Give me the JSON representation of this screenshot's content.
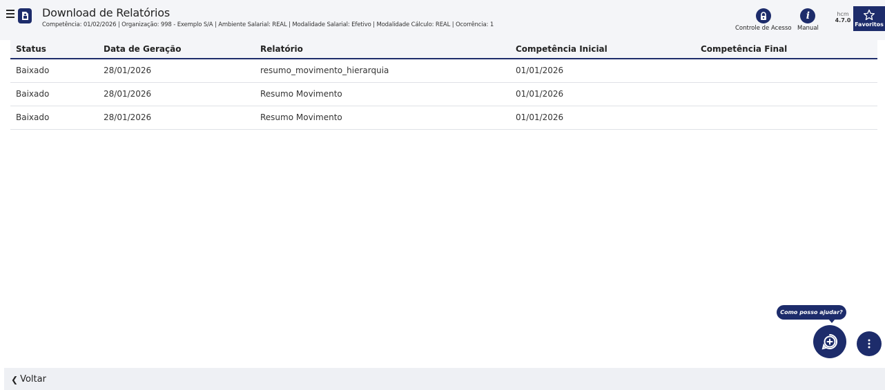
{
  "header": {
    "title": "Download de Relatórios",
    "context_line": "Competência: 01/02/2026 | Organização: 998 - Exemplo S/A | Ambiente Salarial: REAL | Modalidade Salarial: Efetivo | Modalidade Cálculo: REAL | Ocorrência: 1",
    "access_control_label": "Controle de Acesso",
    "manual_label": "Manual",
    "version_app": "hcm",
    "version_number": "4.7.0",
    "favorites_label": "Favoritos"
  },
  "table": {
    "columns": [
      "Status",
      "Data de Geração",
      "Relatório",
      "Competência Inicial",
      "Competência Final"
    ],
    "rows": [
      {
        "status": "Baixado",
        "generated_on": "28/01/2026",
        "report": "resumo_movimento_hierarquia",
        "start": "01/01/2026",
        "end": ""
      },
      {
        "status": "Baixado",
        "generated_on": "28/01/2026",
        "report": "Resumo Movimento",
        "start": "01/01/2026",
        "end": ""
      },
      {
        "status": "Baixado",
        "generated_on": "28/01/2026",
        "report": "Resumo Movimento",
        "start": "01/01/2026",
        "end": ""
      }
    ]
  },
  "assistant": {
    "prompt": "Como posso ajudar?"
  },
  "footer": {
    "back_label": "Voltar"
  },
  "icons": {
    "menu": "hamburger-icon",
    "app": "report-document-icon",
    "access_control": "lock-icon",
    "manual": "info-icon",
    "favorites": "star-icon",
    "assistant": "chat-plus-icon",
    "more": "vertical-dots-icon",
    "back": "chevron-left-icon"
  },
  "colors": {
    "brand": "#1d2c6b",
    "header_bg": "#f4f5f8",
    "row_divider": "#dfe1e6"
  }
}
